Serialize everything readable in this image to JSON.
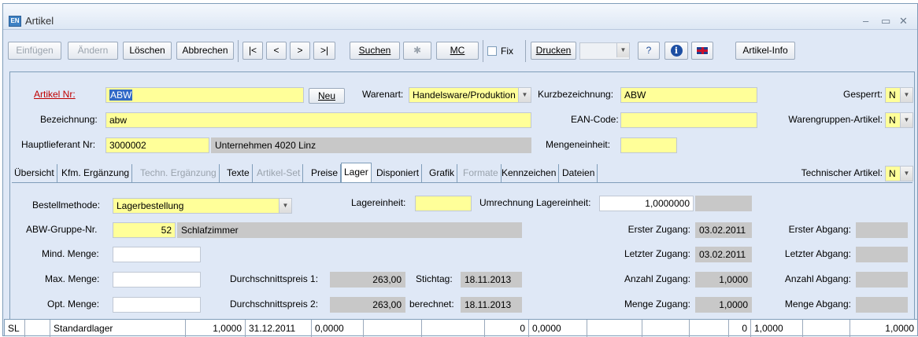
{
  "window": {
    "title": "Artikel",
    "icon_label": "EN"
  },
  "toolbar": {
    "einfuegen": "Einfügen",
    "aendern": "Ändern",
    "loeschen": "Löschen",
    "abbrechen": "Abbrechen",
    "first": "|<",
    "prev": "<",
    "next": ">",
    "last": ">|",
    "suchen": "Suchen",
    "mc": "MC",
    "fix": "Fix",
    "drucken": "Drucken",
    "help": "?",
    "artikel_info": "Artikel-Info"
  },
  "header": {
    "artikel_nr_label": "Artikel Nr:",
    "artikel_nr": "ABW",
    "neu": "Neu",
    "warenart_label": "Warenart:",
    "warenart": "Handelsware/Produktion",
    "kurzbezeichnung_label": "Kurzbezeichnung:",
    "kurzbezeichnung": "ABW",
    "gesperrt_label": "Gesperrt:",
    "gesperrt": "N",
    "bezeichnung_label": "Bezeichnung:",
    "bezeichnung": "abw",
    "ean_label": "EAN-Code:",
    "ean": "",
    "warengruppen_label": "Warengruppen-Artikel:",
    "warengruppen": "N",
    "hauptlieferant_label": "Hauptlieferant Nr:",
    "hauptlieferant": "3000002",
    "lieferant_name": "Unternehmen 4020 Linz",
    "mengeneinheit_label": "Mengeneinheit:",
    "mengeneinheit": "",
    "technischer_label": "Technischer Artikel:",
    "technischer": "N"
  },
  "tabs": [
    {
      "label": "Übersicht",
      "state": "normal"
    },
    {
      "label": "Kfm. Ergänzung",
      "state": "normal"
    },
    {
      "label": "Techn. Ergänzung",
      "state": "disabled"
    },
    {
      "label": "Texte",
      "state": "normal"
    },
    {
      "label": "Artikel-Set",
      "state": "disabled"
    },
    {
      "label": "Preise",
      "state": "normal"
    },
    {
      "label": "Lager",
      "state": "active"
    },
    {
      "label": "Disponiert",
      "state": "normal"
    },
    {
      "label": "Grafik",
      "state": "normal"
    },
    {
      "label": "Formate",
      "state": "disabled"
    },
    {
      "label": "Kennzeichen",
      "state": "normal"
    },
    {
      "label": "Dateien",
      "state": "normal"
    }
  ],
  "lager": {
    "bestellmethode_label": "Bestellmethode:",
    "bestellmethode": "Lagerbestellung",
    "lagereinheit_label": "Lagereinheit:",
    "lagereinheit": "",
    "umrechnung_label": "Umrechnung Lagereinheit:",
    "umrechnung": "1,0000000",
    "umrechnung_extra": "",
    "abw_gruppe_label": "ABW-Gruppe-Nr.",
    "abw_gruppe": "52",
    "abw_gruppe_name": "Schlafzimmer",
    "mind_menge_label": "Mind. Menge:",
    "mind_menge": "",
    "max_menge_label": "Max. Menge:",
    "max_menge": "",
    "opt_menge_label": "Opt. Menge:",
    "opt_menge": "",
    "dp1_label": "Durchschnittspreis 1:",
    "dp1": "263,00",
    "stichtag_label": "Stichtag:",
    "stichtag": "18.11.2013",
    "dp2_label": "Durchschnittspreis 2:",
    "dp2": "263,00",
    "berechnet_label": "berechnet:",
    "berechnet": "18.11.2013",
    "erster_zugang_label": "Erster Zugang:",
    "erster_zugang": "03.02.2011",
    "letzter_zugang_label": "Letzter Zugang:",
    "letzter_zugang": "03.02.2011",
    "anzahl_zugang_label": "Anzahl Zugang:",
    "anzahl_zugang": "1,0000",
    "menge_zugang_label": "Menge Zugang:",
    "menge_zugang": "1,0000",
    "erster_abgang_label": "Erster Abgang:",
    "erster_abgang": "",
    "letzter_abgang_label": "Letzter Abgang:",
    "letzter_abgang": "",
    "anzahl_abgang_label": "Anzahl Abgang:",
    "anzahl_abgang": "",
    "menge_abgang_label": "Menge Abgang:",
    "menge_abgang": ""
  },
  "grid_row": [
    "SL",
    "Standardlager",
    "1,0000",
    "31.12.2011",
    "0,0000",
    "",
    "",
    "0",
    "0,0000",
    "",
    "",
    "",
    "0",
    "1,0000",
    "",
    "1,0000"
  ],
  "colors": {
    "accent": "#3169c6",
    "required": "#ffff99",
    "panel": "#dfe8f6"
  }
}
